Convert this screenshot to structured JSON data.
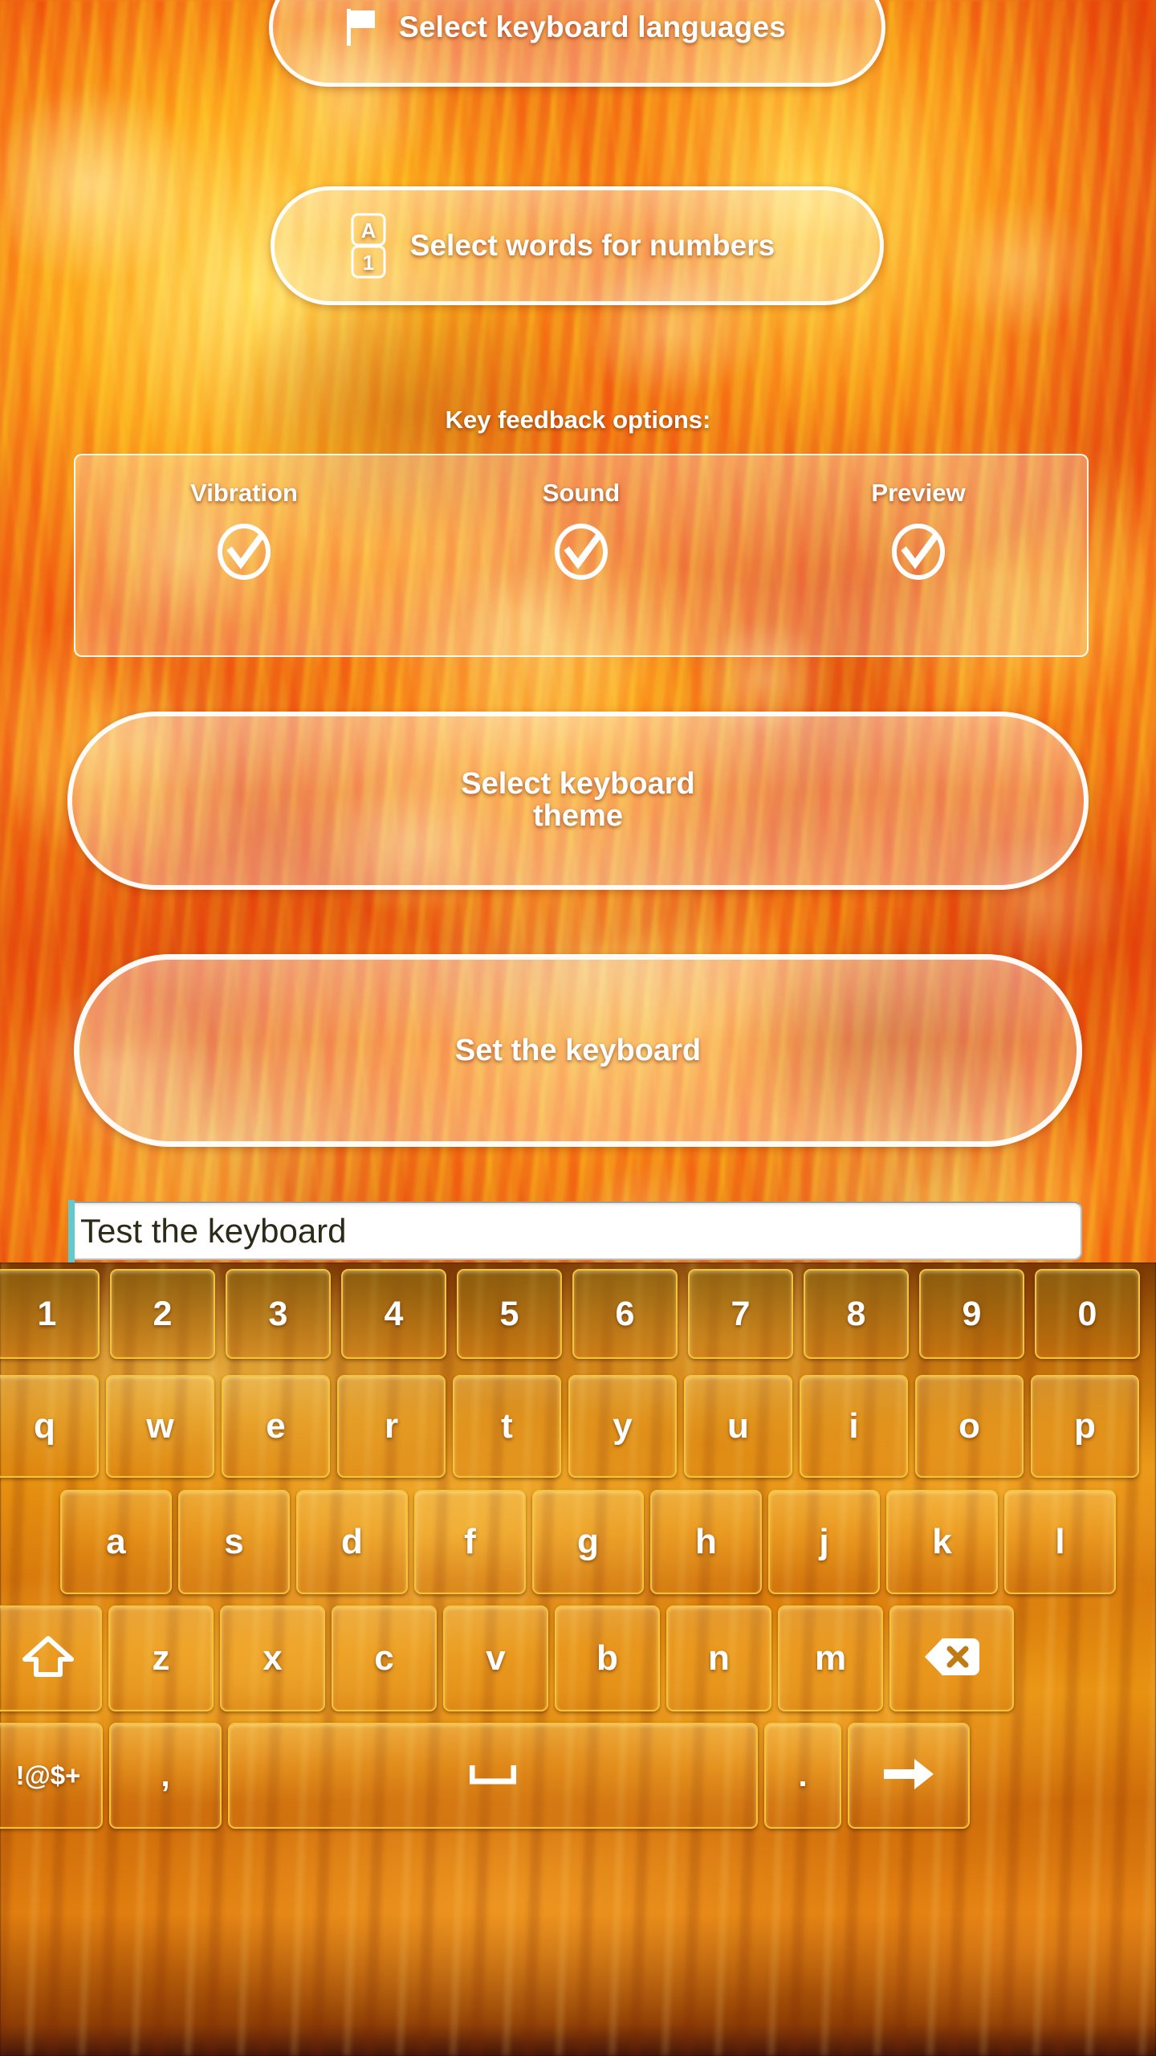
{
  "app": {
    "background_theme": "fire",
    "accent_color": "#F6C333",
    "border_color": "#FFFFFF"
  },
  "settings": {
    "languages_button": {
      "label": "Select keyboard languages",
      "icon": "flag-icon"
    },
    "words_for_numbers_button": {
      "label": "Select words for numbers",
      "icon": "a-over-1-icon",
      "icon_top_char": "A",
      "icon_bottom_char": "1"
    },
    "key_feedback": {
      "title": "Key feedback options:",
      "options": [
        {
          "label": "Vibration",
          "checked": true,
          "icon": "check-circle-icon"
        },
        {
          "label": "Sound",
          "checked": true,
          "icon": "check-circle-icon"
        },
        {
          "label": "Preview",
          "checked": true,
          "icon": "check-circle-icon"
        }
      ]
    },
    "theme_button": {
      "line1": "Select keyboard",
      "line2": "theme"
    },
    "set_keyboard_button": {
      "label": "Set the keyboard"
    }
  },
  "test_field": {
    "value": "Test the keyboard",
    "placeholder": "Test the keyboard",
    "caret_color": "#63C9CE",
    "text_color": "#2B2B18"
  },
  "keyboard": {
    "layout": "qwerty-lowercase",
    "rows": {
      "numbers": [
        "1",
        "2",
        "3",
        "4",
        "5",
        "6",
        "7",
        "8",
        "9",
        "0"
      ],
      "top": [
        "q",
        "w",
        "e",
        "r",
        "t",
        "y",
        "u",
        "i",
        "o",
        "p"
      ],
      "home": [
        "a",
        "s",
        "d",
        "f",
        "g",
        "h",
        "j",
        "k",
        "l"
      ],
      "bottom": [
        "z",
        "x",
        "c",
        "v",
        "b",
        "n",
        "m"
      ]
    },
    "shift_key": {
      "label": "",
      "icon": "shift-arrow-icon"
    },
    "backspace_key": {
      "label": "",
      "icon": "backspace-icon"
    },
    "symbols_key": {
      "label": "!@$+",
      "icon": "symbols-key"
    },
    "comma_key": {
      "label": ",",
      "icon": "comma-key"
    },
    "space_key": {
      "label": "",
      "icon": "space-bar-icon"
    },
    "period_key": {
      "label": ".",
      "icon": "period-key"
    },
    "enter_key": {
      "label": "",
      "icon": "arrow-right-icon"
    }
  }
}
